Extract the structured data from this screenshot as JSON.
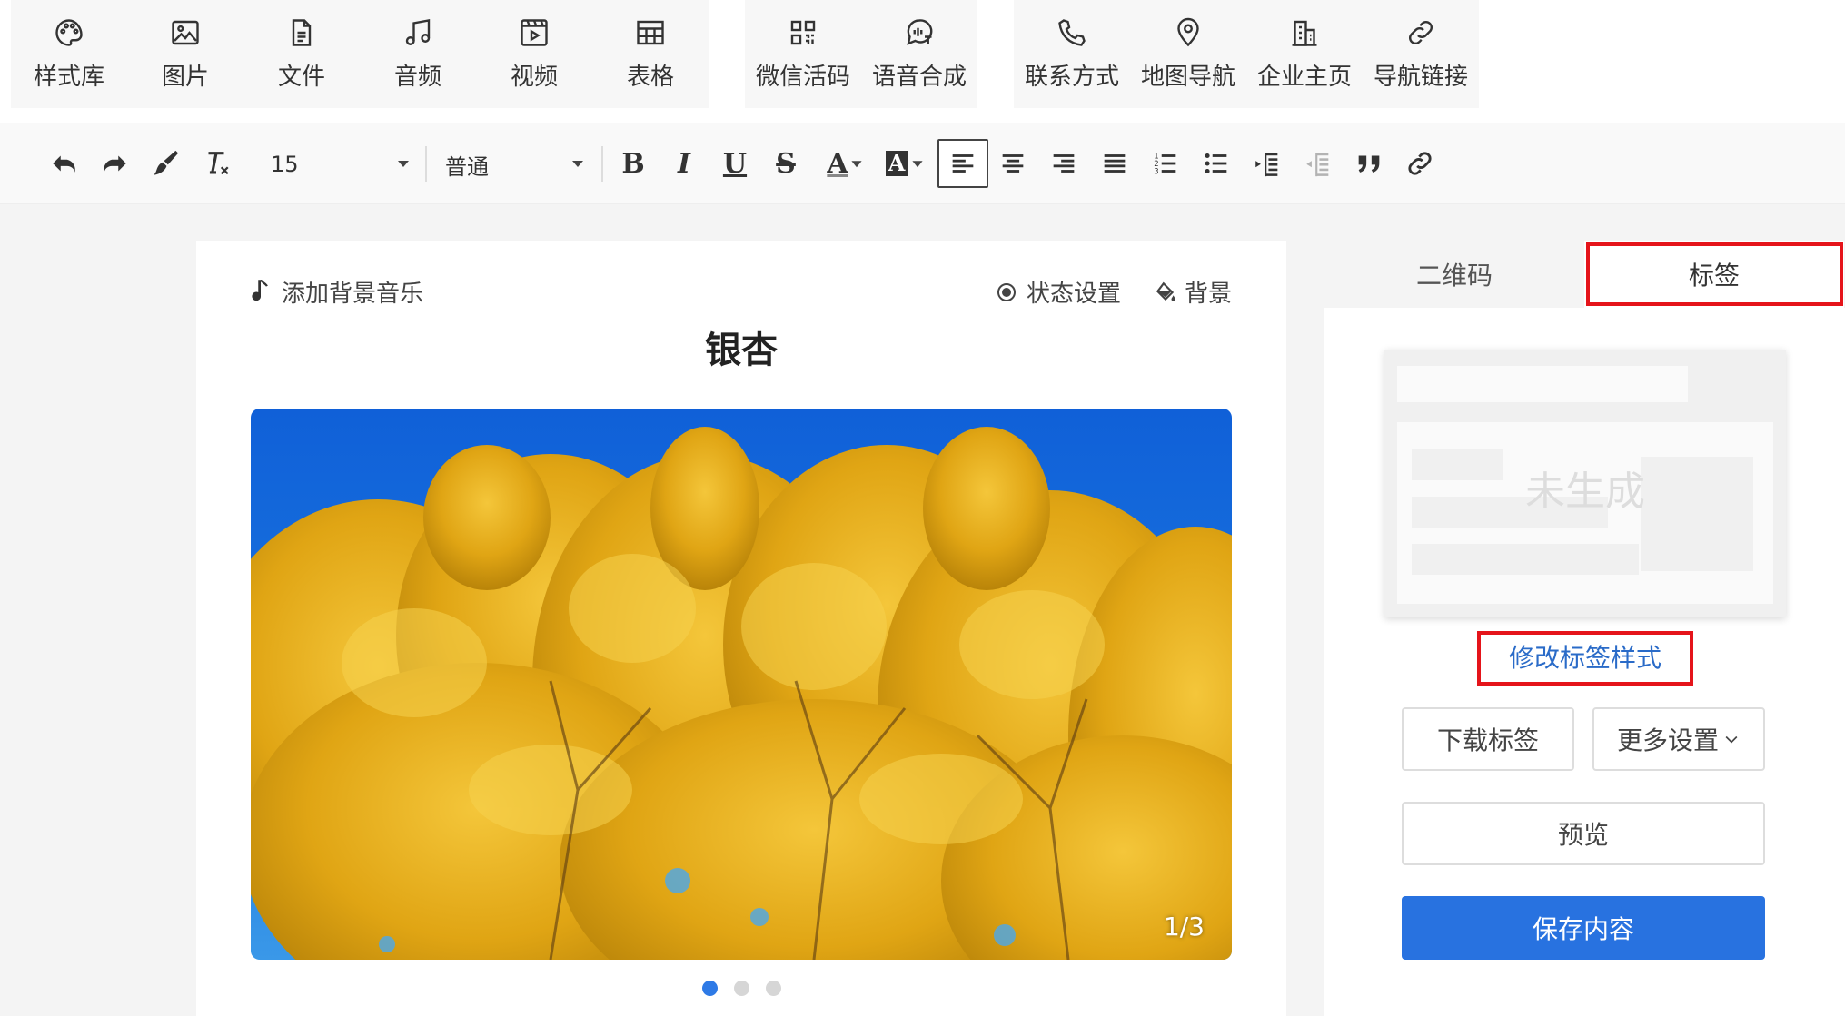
{
  "insert_toolbar": {
    "group1": [
      "样式库",
      "图片",
      "文件",
      "音频",
      "视频",
      "表格"
    ],
    "group2": [
      "微信活码",
      "语音合成"
    ],
    "group3": [
      "联系方式",
      "地图导航",
      "企业主页",
      "导航链接"
    ]
  },
  "format_toolbar": {
    "font_size": "15",
    "paragraph_style": "普通",
    "bold": "B",
    "italic": "I",
    "underline": "U",
    "strike": "S",
    "font_color": "A",
    "bg_color": "A"
  },
  "editor": {
    "add_music": "添加背景音乐",
    "state_settings": "状态设置",
    "background": "背景",
    "title": "银杏",
    "image_counter": "1/3",
    "carousel_active_index": 0,
    "carousel_count": 3
  },
  "panel": {
    "tabs": [
      "二维码",
      "标签"
    ],
    "active_tab": 1,
    "label_status": "未生成",
    "modify_style": "修改标签样式",
    "download": "下载标签",
    "more_settings": "更多设置",
    "preview": "预览",
    "save": "保存内容"
  },
  "colors": {
    "accent": "#2872e0",
    "link": "#2a6bc8",
    "highlight": "#e5141a"
  }
}
